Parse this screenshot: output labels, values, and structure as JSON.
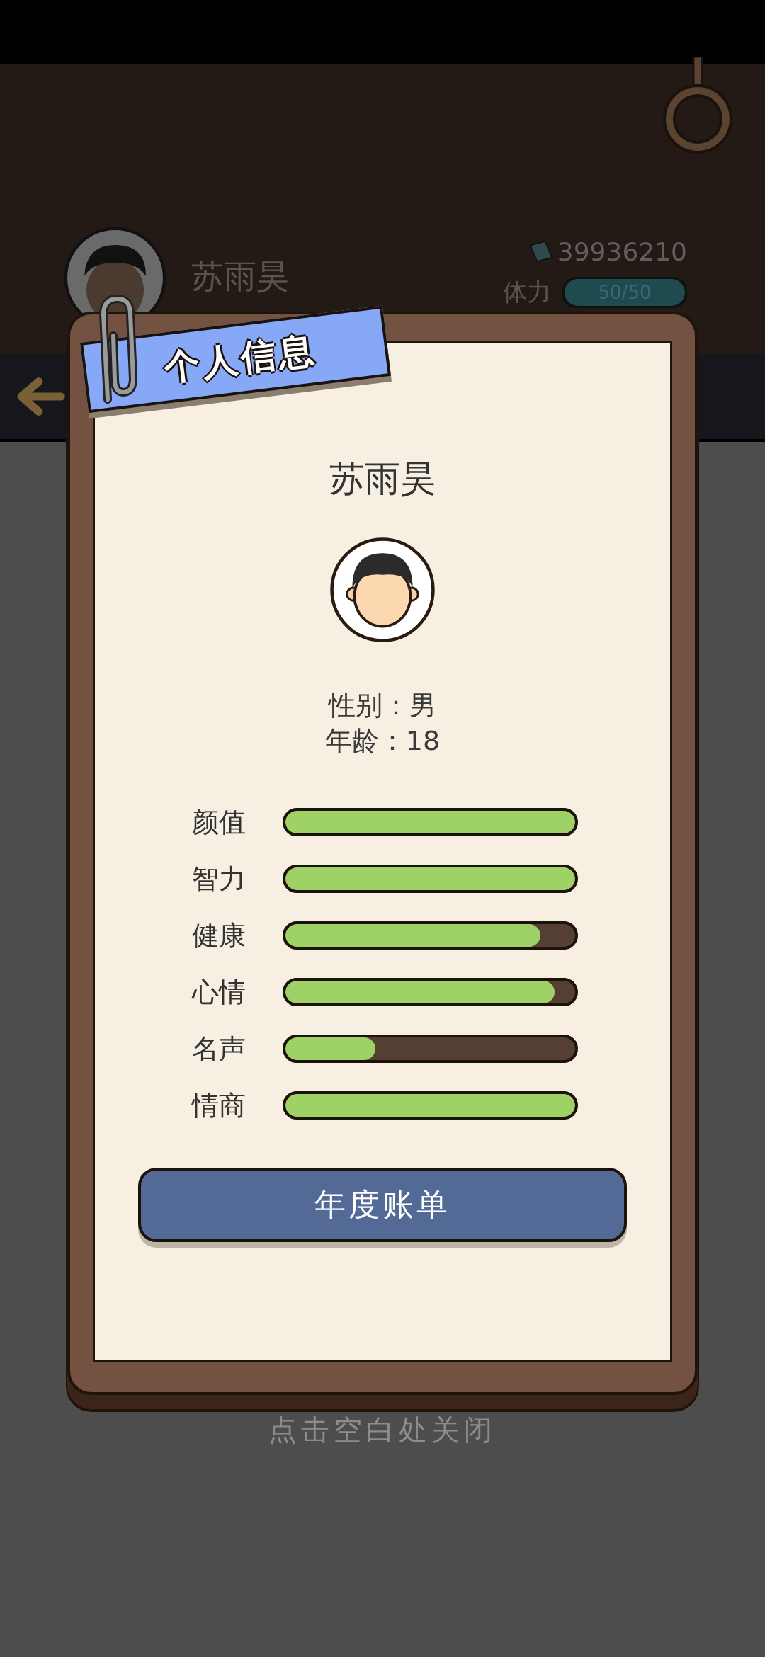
{
  "header": {
    "name": "苏雨昊",
    "money": "39936210",
    "stamina_label": "体力",
    "stamina": {
      "reading": "50/50",
      "level": 1
    }
  },
  "dialog": {
    "tab_title": "个人信息",
    "name": "苏雨昊",
    "gender": "性别：男",
    "age": "年龄：18",
    "stats": [
      {
        "label": "颜值",
        "level": 1
      },
      {
        "label": "智力",
        "level": 1
      },
      {
        "label": "健康",
        "level": 0.88
      },
      {
        "label": "心情",
        "level": 0.93
      },
      {
        "label": "名声",
        "level": 0.31
      },
      {
        "label": "情商",
        "level": 1
      }
    ],
    "button": "年度账单"
  },
  "hint": "点击空白处关闭"
}
